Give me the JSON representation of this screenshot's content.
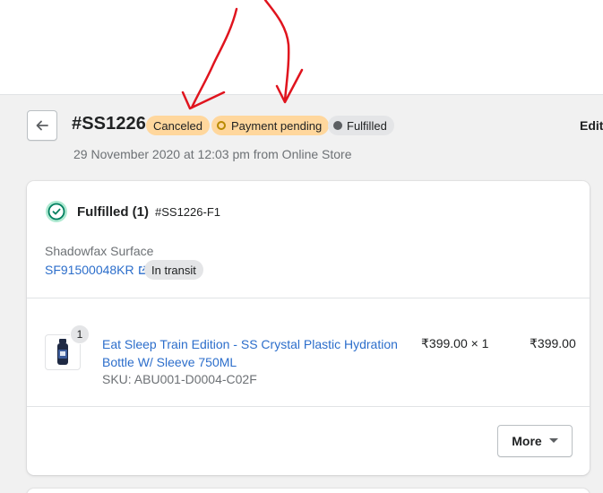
{
  "order": {
    "title": "#SS1226",
    "badges": {
      "canceled": "Canceled",
      "payment": "Payment pending",
      "fulfilled": "Fulfilled"
    },
    "subtitle": "29 November 2020 at 12:03 pm from Online Store",
    "edit_label": "Edit"
  },
  "fulfillment": {
    "status_title": "Fulfilled (1)",
    "fulfillment_id": "#SS1226-F1",
    "carrier": "Shadowfax Surface",
    "tracking_number": "SF91500048KR",
    "tracking_status": "In transit"
  },
  "line_item": {
    "quantity_badge": "1",
    "product_name": "Eat Sleep Train Edition - SS Crystal Plastic Hydration Bottle W/ Sleeve 750ML",
    "sku": "SKU: ABU001-D0004-C02F",
    "unit_price": "₹399.00 × 1",
    "total": "₹399.00"
  },
  "actions": {
    "more_label": "More"
  },
  "colors": {
    "annotation": "#e0141e",
    "attention_badge": "#ffd79d",
    "neutral_badge": "#e4e5e7",
    "link": "#2c6ecb",
    "success": "#008060"
  }
}
